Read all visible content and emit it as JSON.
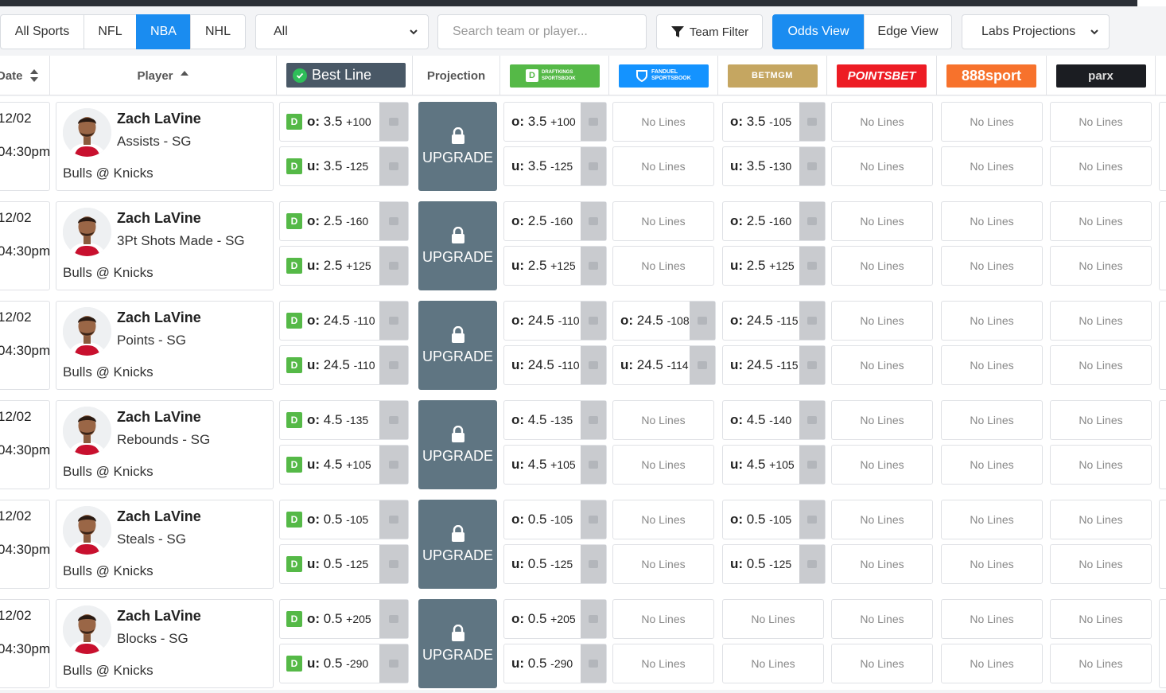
{
  "sports_tabs": [
    {
      "label": "All Sports",
      "active": false
    },
    {
      "label": "NFL",
      "active": false
    },
    {
      "label": "NBA",
      "active": true
    },
    {
      "label": "NHL",
      "active": false
    }
  ],
  "filter_select": {
    "value": "All"
  },
  "search": {
    "placeholder": "Search team or player..."
  },
  "team_filter": {
    "label": "Team Filter"
  },
  "view_toggle": [
    {
      "label": "Odds View",
      "active": true
    },
    {
      "label": "Edge View",
      "active": false
    }
  ],
  "projections_select": {
    "value": "Labs Projections"
  },
  "colors": {
    "accent": "#1a8cf0",
    "upgrade": "#5f7582",
    "best_line": "#495866",
    "draftkings": "#55b947",
    "fanduel": "#1493ff",
    "betmgm": "#c5a661",
    "pointsbet": "#ed1c24",
    "sport888": "#f7722c",
    "parx": "#1b1d22"
  },
  "header": {
    "date": "Date",
    "player": "Player",
    "best_line": "Best Line",
    "projection": "Projection",
    "books": [
      {
        "name": "DraftKings Sportsbook",
        "logo_text": "DRAFTKINGS SPORTSBOOK"
      },
      {
        "name": "FanDuel Sportsbook",
        "logo_text": "FANDUEL SPORTSBOOK"
      },
      {
        "name": "BetMGM",
        "logo_text": "BETMGM"
      },
      {
        "name": "PointsBet",
        "logo_text": "POINTSBET"
      },
      {
        "name": "888sport",
        "logo_text": "888sport"
      },
      {
        "name": "Parx Sportsbook",
        "logo_text": "parx"
      }
    ]
  },
  "upgrade_label": "UPGRADE",
  "no_lines_label": "No Lines",
  "rows": [
    {
      "date": "12/02",
      "time": "04:30pm",
      "player": "Zach LaVine",
      "prop": "Assists - SG",
      "game": "Bulls @ Knicks",
      "best": [
        {
          "side": "o:",
          "line": "3.5",
          "odds": "+100"
        },
        {
          "side": "u:",
          "line": "3.5",
          "odds": "-125"
        }
      ],
      "books": [
        [
          {
            "side": "o:",
            "line": "3.5",
            "odds": "+100"
          },
          {
            "side": "u:",
            "line": "3.5",
            "odds": "-125"
          }
        ],
        null,
        [
          {
            "side": "o:",
            "line": "3.5",
            "odds": "-105"
          },
          {
            "side": "u:",
            "line": "3.5",
            "odds": "-130"
          }
        ],
        null,
        null,
        null
      ]
    },
    {
      "date": "12/02",
      "time": "04:30pm",
      "player": "Zach LaVine",
      "prop": "3Pt Shots Made - SG",
      "game": "Bulls @ Knicks",
      "best": [
        {
          "side": "o:",
          "line": "2.5",
          "odds": "-160"
        },
        {
          "side": "u:",
          "line": "2.5",
          "odds": "+125"
        }
      ],
      "books": [
        [
          {
            "side": "o:",
            "line": "2.5",
            "odds": "-160"
          },
          {
            "side": "u:",
            "line": "2.5",
            "odds": "+125"
          }
        ],
        null,
        [
          {
            "side": "o:",
            "line": "2.5",
            "odds": "-160"
          },
          {
            "side": "u:",
            "line": "2.5",
            "odds": "+125"
          }
        ],
        null,
        null,
        null
      ]
    },
    {
      "date": "12/02",
      "time": "04:30pm",
      "player": "Zach LaVine",
      "prop": "Points - SG",
      "game": "Bulls @ Knicks",
      "best": [
        {
          "side": "o:",
          "line": "24.5",
          "odds": "-110"
        },
        {
          "side": "u:",
          "line": "24.5",
          "odds": "-110"
        }
      ],
      "books": [
        [
          {
            "side": "o:",
            "line": "24.5",
            "odds": "-110"
          },
          {
            "side": "u:",
            "line": "24.5",
            "odds": "-110"
          }
        ],
        [
          {
            "side": "o:",
            "line": "24.5",
            "odds": "-108"
          },
          {
            "side": "u:",
            "line": "24.5",
            "odds": "-114"
          }
        ],
        [
          {
            "side": "o:",
            "line": "24.5",
            "odds": "-115"
          },
          {
            "side": "u:",
            "line": "24.5",
            "odds": "-115"
          }
        ],
        null,
        null,
        null
      ]
    },
    {
      "date": "12/02",
      "time": "04:30pm",
      "player": "Zach LaVine",
      "prop": "Rebounds - SG",
      "game": "Bulls @ Knicks",
      "best": [
        {
          "side": "o:",
          "line": "4.5",
          "odds": "-135"
        },
        {
          "side": "u:",
          "line": "4.5",
          "odds": "+105"
        }
      ],
      "books": [
        [
          {
            "side": "o:",
            "line": "4.5",
            "odds": "-135"
          },
          {
            "side": "u:",
            "line": "4.5",
            "odds": "+105"
          }
        ],
        null,
        [
          {
            "side": "o:",
            "line": "4.5",
            "odds": "-140"
          },
          {
            "side": "u:",
            "line": "4.5",
            "odds": "+105"
          }
        ],
        null,
        null,
        null
      ]
    },
    {
      "date": "12/02",
      "time": "04:30pm",
      "player": "Zach LaVine",
      "prop": "Steals - SG",
      "game": "Bulls @ Knicks",
      "best": [
        {
          "side": "o:",
          "line": "0.5",
          "odds": "-105"
        },
        {
          "side": "u:",
          "line": "0.5",
          "odds": "-125"
        }
      ],
      "books": [
        [
          {
            "side": "o:",
            "line": "0.5",
            "odds": "-105"
          },
          {
            "side": "u:",
            "line": "0.5",
            "odds": "-125"
          }
        ],
        null,
        [
          {
            "side": "o:",
            "line": "0.5",
            "odds": "-105"
          },
          {
            "side": "u:",
            "line": "0.5",
            "odds": "-125"
          }
        ],
        null,
        null,
        null
      ]
    },
    {
      "date": "12/02",
      "time": "04:30pm",
      "player": "Zach LaVine",
      "prop": "Blocks - SG",
      "game": "Bulls @ Knicks",
      "best": [
        {
          "side": "o:",
          "line": "0.5",
          "odds": "+205"
        },
        {
          "side": "u:",
          "line": "0.5",
          "odds": "-290"
        }
      ],
      "books": [
        [
          {
            "side": "o:",
            "line": "0.5",
            "odds": "+205"
          },
          {
            "side": "u:",
            "line": "0.5",
            "odds": "-290"
          }
        ],
        null,
        null,
        null,
        null,
        null
      ]
    }
  ]
}
